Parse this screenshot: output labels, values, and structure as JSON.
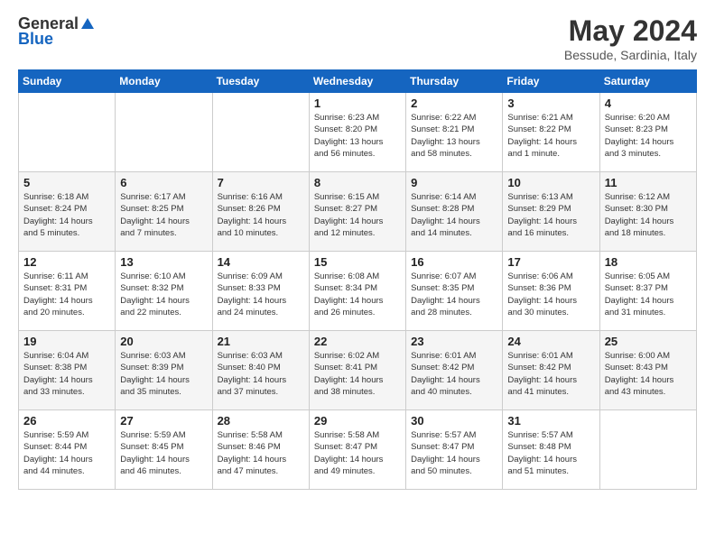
{
  "header": {
    "logo_general": "General",
    "logo_blue": "Blue",
    "month_year": "May 2024",
    "location": "Bessude, Sardinia, Italy"
  },
  "weekdays": [
    "Sunday",
    "Monday",
    "Tuesday",
    "Wednesday",
    "Thursday",
    "Friday",
    "Saturday"
  ],
  "weeks": [
    [
      {
        "day": "",
        "info": ""
      },
      {
        "day": "",
        "info": ""
      },
      {
        "day": "",
        "info": ""
      },
      {
        "day": "1",
        "info": "Sunrise: 6:23 AM\nSunset: 8:20 PM\nDaylight: 13 hours\nand 56 minutes."
      },
      {
        "day": "2",
        "info": "Sunrise: 6:22 AM\nSunset: 8:21 PM\nDaylight: 13 hours\nand 58 minutes."
      },
      {
        "day": "3",
        "info": "Sunrise: 6:21 AM\nSunset: 8:22 PM\nDaylight: 14 hours\nand 1 minute."
      },
      {
        "day": "4",
        "info": "Sunrise: 6:20 AM\nSunset: 8:23 PM\nDaylight: 14 hours\nand 3 minutes."
      }
    ],
    [
      {
        "day": "5",
        "info": "Sunrise: 6:18 AM\nSunset: 8:24 PM\nDaylight: 14 hours\nand 5 minutes."
      },
      {
        "day": "6",
        "info": "Sunrise: 6:17 AM\nSunset: 8:25 PM\nDaylight: 14 hours\nand 7 minutes."
      },
      {
        "day": "7",
        "info": "Sunrise: 6:16 AM\nSunset: 8:26 PM\nDaylight: 14 hours\nand 10 minutes."
      },
      {
        "day": "8",
        "info": "Sunrise: 6:15 AM\nSunset: 8:27 PM\nDaylight: 14 hours\nand 12 minutes."
      },
      {
        "day": "9",
        "info": "Sunrise: 6:14 AM\nSunset: 8:28 PM\nDaylight: 14 hours\nand 14 minutes."
      },
      {
        "day": "10",
        "info": "Sunrise: 6:13 AM\nSunset: 8:29 PM\nDaylight: 14 hours\nand 16 minutes."
      },
      {
        "day": "11",
        "info": "Sunrise: 6:12 AM\nSunset: 8:30 PM\nDaylight: 14 hours\nand 18 minutes."
      }
    ],
    [
      {
        "day": "12",
        "info": "Sunrise: 6:11 AM\nSunset: 8:31 PM\nDaylight: 14 hours\nand 20 minutes."
      },
      {
        "day": "13",
        "info": "Sunrise: 6:10 AM\nSunset: 8:32 PM\nDaylight: 14 hours\nand 22 minutes."
      },
      {
        "day": "14",
        "info": "Sunrise: 6:09 AM\nSunset: 8:33 PM\nDaylight: 14 hours\nand 24 minutes."
      },
      {
        "day": "15",
        "info": "Sunrise: 6:08 AM\nSunset: 8:34 PM\nDaylight: 14 hours\nand 26 minutes."
      },
      {
        "day": "16",
        "info": "Sunrise: 6:07 AM\nSunset: 8:35 PM\nDaylight: 14 hours\nand 28 minutes."
      },
      {
        "day": "17",
        "info": "Sunrise: 6:06 AM\nSunset: 8:36 PM\nDaylight: 14 hours\nand 30 minutes."
      },
      {
        "day": "18",
        "info": "Sunrise: 6:05 AM\nSunset: 8:37 PM\nDaylight: 14 hours\nand 31 minutes."
      }
    ],
    [
      {
        "day": "19",
        "info": "Sunrise: 6:04 AM\nSunset: 8:38 PM\nDaylight: 14 hours\nand 33 minutes."
      },
      {
        "day": "20",
        "info": "Sunrise: 6:03 AM\nSunset: 8:39 PM\nDaylight: 14 hours\nand 35 minutes."
      },
      {
        "day": "21",
        "info": "Sunrise: 6:03 AM\nSunset: 8:40 PM\nDaylight: 14 hours\nand 37 minutes."
      },
      {
        "day": "22",
        "info": "Sunrise: 6:02 AM\nSunset: 8:41 PM\nDaylight: 14 hours\nand 38 minutes."
      },
      {
        "day": "23",
        "info": "Sunrise: 6:01 AM\nSunset: 8:42 PM\nDaylight: 14 hours\nand 40 minutes."
      },
      {
        "day": "24",
        "info": "Sunrise: 6:01 AM\nSunset: 8:42 PM\nDaylight: 14 hours\nand 41 minutes."
      },
      {
        "day": "25",
        "info": "Sunrise: 6:00 AM\nSunset: 8:43 PM\nDaylight: 14 hours\nand 43 minutes."
      }
    ],
    [
      {
        "day": "26",
        "info": "Sunrise: 5:59 AM\nSunset: 8:44 PM\nDaylight: 14 hours\nand 44 minutes."
      },
      {
        "day": "27",
        "info": "Sunrise: 5:59 AM\nSunset: 8:45 PM\nDaylight: 14 hours\nand 46 minutes."
      },
      {
        "day": "28",
        "info": "Sunrise: 5:58 AM\nSunset: 8:46 PM\nDaylight: 14 hours\nand 47 minutes."
      },
      {
        "day": "29",
        "info": "Sunrise: 5:58 AM\nSunset: 8:47 PM\nDaylight: 14 hours\nand 49 minutes."
      },
      {
        "day": "30",
        "info": "Sunrise: 5:57 AM\nSunset: 8:47 PM\nDaylight: 14 hours\nand 50 minutes."
      },
      {
        "day": "31",
        "info": "Sunrise: 5:57 AM\nSunset: 8:48 PM\nDaylight: 14 hours\nand 51 minutes."
      },
      {
        "day": "",
        "info": ""
      }
    ]
  ]
}
